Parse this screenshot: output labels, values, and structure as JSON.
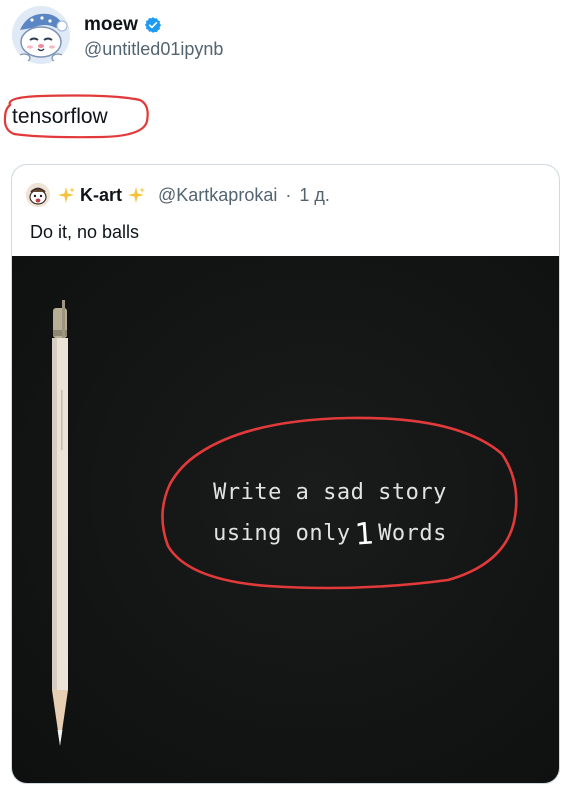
{
  "author": {
    "display_name": "moew",
    "handle": "@untitled01ipynb",
    "verified": true,
    "avatar_icon": "cat-avatar-icon"
  },
  "tweet": {
    "text": "tensorflow",
    "annotation_color": "#e23a3a"
  },
  "quote": {
    "display_name": "K-art",
    "handle": "@Kartkaprokai",
    "separator": "·",
    "time": "1 д.",
    "text": "Do it, no balls",
    "avatar_icon": "character-avatar-icon",
    "name_decoration_icon": "sparkles-icon"
  },
  "media": {
    "line1": "Write a sad story",
    "line2_pre": "using only",
    "line2_number": "1",
    "line2_post": "Words",
    "object_icon": "pencil-icon",
    "background_color": "#141616"
  },
  "colors": {
    "text_primary": "#0f1419",
    "text_secondary": "#536471",
    "verified_blue": "#1d9bf0",
    "card_border": "#cfd9de",
    "annotation_red": "#e23a3a"
  }
}
